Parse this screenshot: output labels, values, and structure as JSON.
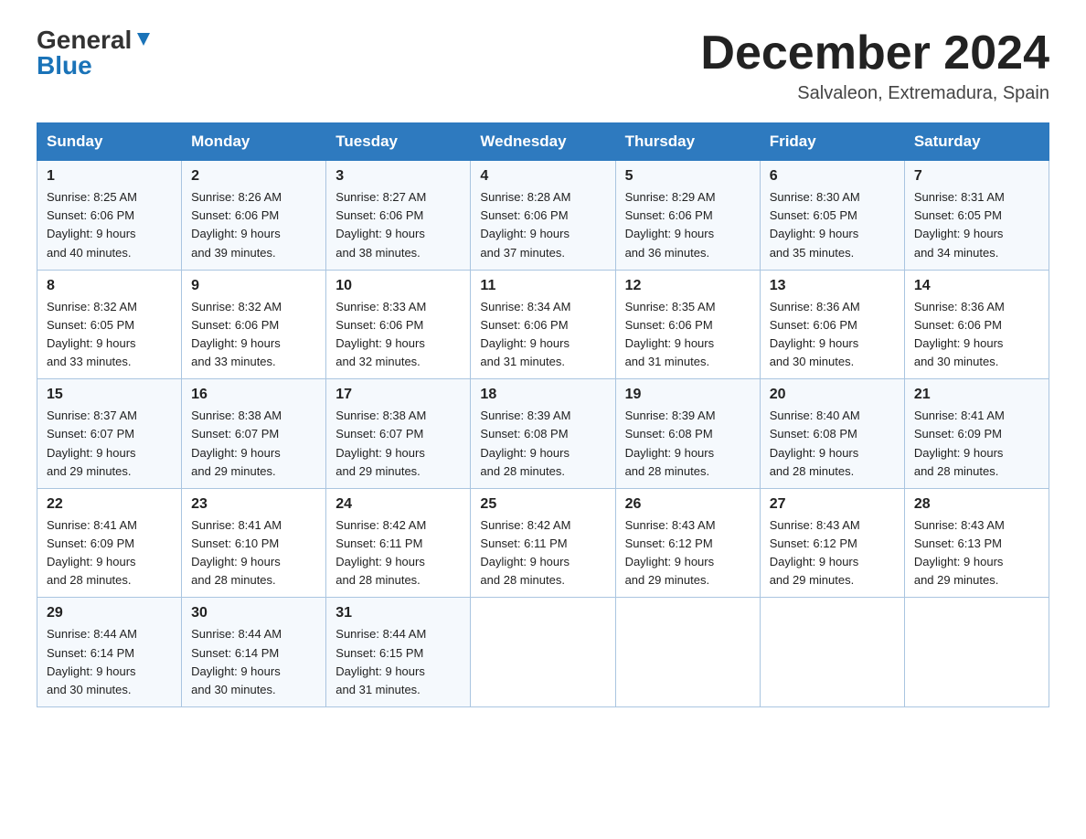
{
  "header": {
    "logo_general": "General",
    "logo_blue": "Blue",
    "month_title": "December 2024",
    "subtitle": "Salvaleon, Extremadura, Spain"
  },
  "weekdays": [
    "Sunday",
    "Monday",
    "Tuesday",
    "Wednesday",
    "Thursday",
    "Friday",
    "Saturday"
  ],
  "weeks": [
    [
      {
        "day": "1",
        "sunrise": "8:25 AM",
        "sunset": "6:06 PM",
        "daylight": "9 hours and 40 minutes."
      },
      {
        "day": "2",
        "sunrise": "8:26 AM",
        "sunset": "6:06 PM",
        "daylight": "9 hours and 39 minutes."
      },
      {
        "day": "3",
        "sunrise": "8:27 AM",
        "sunset": "6:06 PM",
        "daylight": "9 hours and 38 minutes."
      },
      {
        "day": "4",
        "sunrise": "8:28 AM",
        "sunset": "6:06 PM",
        "daylight": "9 hours and 37 minutes."
      },
      {
        "day": "5",
        "sunrise": "8:29 AM",
        "sunset": "6:06 PM",
        "daylight": "9 hours and 36 minutes."
      },
      {
        "day": "6",
        "sunrise": "8:30 AM",
        "sunset": "6:05 PM",
        "daylight": "9 hours and 35 minutes."
      },
      {
        "day": "7",
        "sunrise": "8:31 AM",
        "sunset": "6:05 PM",
        "daylight": "9 hours and 34 minutes."
      }
    ],
    [
      {
        "day": "8",
        "sunrise": "8:32 AM",
        "sunset": "6:05 PM",
        "daylight": "9 hours and 33 minutes."
      },
      {
        "day": "9",
        "sunrise": "8:32 AM",
        "sunset": "6:06 PM",
        "daylight": "9 hours and 33 minutes."
      },
      {
        "day": "10",
        "sunrise": "8:33 AM",
        "sunset": "6:06 PM",
        "daylight": "9 hours and 32 minutes."
      },
      {
        "day": "11",
        "sunrise": "8:34 AM",
        "sunset": "6:06 PM",
        "daylight": "9 hours and 31 minutes."
      },
      {
        "day": "12",
        "sunrise": "8:35 AM",
        "sunset": "6:06 PM",
        "daylight": "9 hours and 31 minutes."
      },
      {
        "day": "13",
        "sunrise": "8:36 AM",
        "sunset": "6:06 PM",
        "daylight": "9 hours and 30 minutes."
      },
      {
        "day": "14",
        "sunrise": "8:36 AM",
        "sunset": "6:06 PM",
        "daylight": "9 hours and 30 minutes."
      }
    ],
    [
      {
        "day": "15",
        "sunrise": "8:37 AM",
        "sunset": "6:07 PM",
        "daylight": "9 hours and 29 minutes."
      },
      {
        "day": "16",
        "sunrise": "8:38 AM",
        "sunset": "6:07 PM",
        "daylight": "9 hours and 29 minutes."
      },
      {
        "day": "17",
        "sunrise": "8:38 AM",
        "sunset": "6:07 PM",
        "daylight": "9 hours and 29 minutes."
      },
      {
        "day": "18",
        "sunrise": "8:39 AM",
        "sunset": "6:08 PM",
        "daylight": "9 hours and 28 minutes."
      },
      {
        "day": "19",
        "sunrise": "8:39 AM",
        "sunset": "6:08 PM",
        "daylight": "9 hours and 28 minutes."
      },
      {
        "day": "20",
        "sunrise": "8:40 AM",
        "sunset": "6:08 PM",
        "daylight": "9 hours and 28 minutes."
      },
      {
        "day": "21",
        "sunrise": "8:41 AM",
        "sunset": "6:09 PM",
        "daylight": "9 hours and 28 minutes."
      }
    ],
    [
      {
        "day": "22",
        "sunrise": "8:41 AM",
        "sunset": "6:09 PM",
        "daylight": "9 hours and 28 minutes."
      },
      {
        "day": "23",
        "sunrise": "8:41 AM",
        "sunset": "6:10 PM",
        "daylight": "9 hours and 28 minutes."
      },
      {
        "day": "24",
        "sunrise": "8:42 AM",
        "sunset": "6:11 PM",
        "daylight": "9 hours and 28 minutes."
      },
      {
        "day": "25",
        "sunrise": "8:42 AM",
        "sunset": "6:11 PM",
        "daylight": "9 hours and 28 minutes."
      },
      {
        "day": "26",
        "sunrise": "8:43 AM",
        "sunset": "6:12 PM",
        "daylight": "9 hours and 29 minutes."
      },
      {
        "day": "27",
        "sunrise": "8:43 AM",
        "sunset": "6:12 PM",
        "daylight": "9 hours and 29 minutes."
      },
      {
        "day": "28",
        "sunrise": "8:43 AM",
        "sunset": "6:13 PM",
        "daylight": "9 hours and 29 minutes."
      }
    ],
    [
      {
        "day": "29",
        "sunrise": "8:44 AM",
        "sunset": "6:14 PM",
        "daylight": "9 hours and 30 minutes."
      },
      {
        "day": "30",
        "sunrise": "8:44 AM",
        "sunset": "6:14 PM",
        "daylight": "9 hours and 30 minutes."
      },
      {
        "day": "31",
        "sunrise": "8:44 AM",
        "sunset": "6:15 PM",
        "daylight": "9 hours and 31 minutes."
      },
      null,
      null,
      null,
      null
    ]
  ],
  "labels": {
    "sunrise": "Sunrise:",
    "sunset": "Sunset:",
    "daylight": "Daylight:"
  }
}
